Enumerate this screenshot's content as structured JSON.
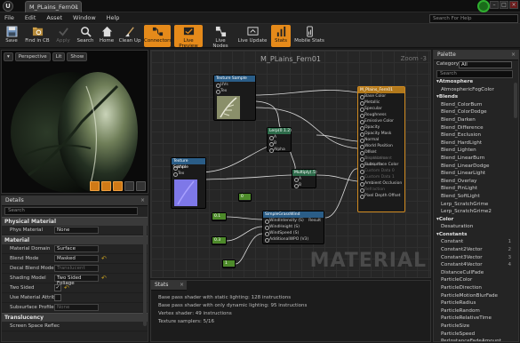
{
  "titlebar": {
    "logo": "U",
    "doc_tab": "M_PLains_Fern01",
    "tab_close": "×",
    "minimize": "–",
    "maximize": "□",
    "close": "×"
  },
  "menu": {
    "items": [
      "File",
      "Edit",
      "Asset",
      "Window",
      "Help"
    ],
    "search_help_placeholder": "Search For Help"
  },
  "toolbar": {
    "items": [
      {
        "label": "Save",
        "icon": "save-icon"
      },
      {
        "label": "Find in CB",
        "icon": "find-in-cb-icon"
      },
      {
        "label": "Apply",
        "icon": "apply-icon"
      },
      {
        "label": "Search",
        "icon": "search-icon"
      },
      {
        "label": "Home",
        "icon": "home-icon"
      },
      {
        "label": "Clean Up",
        "icon": "clean-up-icon"
      },
      {
        "label": "Connectors",
        "icon": "connectors-icon"
      },
      {
        "label": "Live Preview",
        "icon": "live-preview-icon"
      },
      {
        "label": "Live Nodes",
        "icon": "live-nodes-icon"
      },
      {
        "label": "Live Update",
        "icon": "live-update-icon"
      },
      {
        "label": "Stats",
        "icon": "stats-icon"
      },
      {
        "label": "Mobile Stats",
        "icon": "mobile-stats-icon"
      }
    ]
  },
  "viewport": {
    "perspective": "Perspective",
    "lit": "Lit",
    "show": "Show"
  },
  "details": {
    "tab": "Details",
    "search_placeholder": "Search",
    "physical_material": {
      "header": "Physical Material",
      "phys_material_label": "Phys Material",
      "phys_material_value": "None"
    },
    "material": {
      "header": "Material",
      "rows": [
        {
          "label": "Material Domain",
          "value": "Surface"
        },
        {
          "label": "Blend Mode",
          "value": "Masked"
        },
        {
          "label": "Decal Blend Mode",
          "value": "Translucent"
        },
        {
          "label": "Shading Model",
          "value": "Two Sided Foliage"
        }
      ],
      "two_sided_label": "Two Sided",
      "two_sided_check": "✓",
      "use_material_attr_label": "Use Material Attribut",
      "subsurface_profile_label": "Subsurface Profile",
      "subsurface_profile_value": "None"
    },
    "translucency": {
      "header": "Translucency",
      "screen_space_label": "Screen Space Reflec"
    }
  },
  "graph": {
    "title": "M_PLains_Fern01",
    "zoom": "Zoom -3",
    "watermark": "MATERIAL",
    "nodes": {
      "tex1": {
        "title": "Texture Sample",
        "pins": [
          "UVs",
          "Tex"
        ]
      },
      "tex2": {
        "title": "Texture Sample",
        "pins": [
          "UVs",
          "Tex"
        ]
      },
      "lerp": {
        "title": "Lerp(0.1.2)",
        "pins": [
          "A",
          "B",
          "Alpha"
        ]
      },
      "mult": {
        "title": "Multiply(.5)",
        "pins": [
          "A",
          "B"
        ]
      },
      "simple": {
        "title": "SimpleGrassWind",
        "pins": [
          "WindIntensity (S)",
          "WindHeight (S)",
          "WindSpeed (S)",
          "AdditionalWPO (V3)"
        ],
        "result": "Result"
      },
      "consts": [
        "0.1",
        "0.3",
        "1",
        "0"
      ],
      "main": {
        "title": "M_Plains_Fern01",
        "pins": [
          "Base Color",
          "Metallic",
          "Specular",
          "Roughness",
          "Emissive Color",
          "Opacity",
          "Opacity Mask",
          "Normal",
          "World Position Offset",
          "World Displacement",
          "Tessellation Multiplier",
          "Subsurface Color",
          "Custom Data 0",
          "Custom Data 1",
          "Ambient Occlusion",
          "Refraction",
          "Pixel Depth Offset"
        ]
      }
    }
  },
  "stats": {
    "tab": "Stats",
    "lines": [
      "Base pass shader with static lighting: 128 instructions",
      "Base pass shader with only dynamic lighting: 95 instructions",
      "Vertex shader: 49 instructions",
      "Texture samplers: 5/16"
    ]
  },
  "palette": {
    "tab": "Palette",
    "category_label": "Category",
    "category_value": "All",
    "search_placeholder": "Search",
    "items": [
      {
        "label": "Atmosphere",
        "cat": true
      },
      {
        "label": "AtmosphericFogColor"
      },
      {
        "label": "Blends",
        "cat": true
      },
      {
        "label": "Blend_ColorBurn"
      },
      {
        "label": "Blend_ColorDodge"
      },
      {
        "label": "Blend_Darken"
      },
      {
        "label": "Blend_Difference"
      },
      {
        "label": "Blend_Exclusion"
      },
      {
        "label": "Blend_HardLight"
      },
      {
        "label": "Blend_Lighten"
      },
      {
        "label": "Blend_LinearBurn"
      },
      {
        "label": "Blend_LinearDodge"
      },
      {
        "label": "Blend_LinearLight"
      },
      {
        "label": "Blend_Overlay"
      },
      {
        "label": "Blend_PinLight"
      },
      {
        "label": "Blend_SoftLight"
      },
      {
        "label": "Lerp_ScratchGrime"
      },
      {
        "label": "Lerp_ScratchGrime2"
      },
      {
        "label": "Color",
        "cat": true
      },
      {
        "label": "Desaturation"
      },
      {
        "label": "Constants",
        "cat": true
      },
      {
        "label": "Constant",
        "num": "1"
      },
      {
        "label": "Constant2Vector",
        "num": "2"
      },
      {
        "label": "Constant3Vector",
        "num": "3"
      },
      {
        "label": "Constant4Vector",
        "num": "4"
      },
      {
        "label": "DistanceCullFade"
      },
      {
        "label": "ParticleColor"
      },
      {
        "label": "ParticleDirection"
      },
      {
        "label": "ParticleMotionBlurFade"
      },
      {
        "label": "ParticleRadius"
      },
      {
        "label": "ParticleRandom"
      },
      {
        "label": "ParticleRelativeTime"
      },
      {
        "label": "ParticleSize"
      },
      {
        "label": "ParticleSpeed"
      },
      {
        "label": "PerInstanceFadeAmount"
      }
    ]
  },
  "colors": {
    "accent": "#e58a1a",
    "record_green": "#2fae2f",
    "node_main": "#b2791c",
    "node_tex": "#2a5d87",
    "node_lerp": "#2d6b4a",
    "node_const": "#4d8a2a"
  }
}
